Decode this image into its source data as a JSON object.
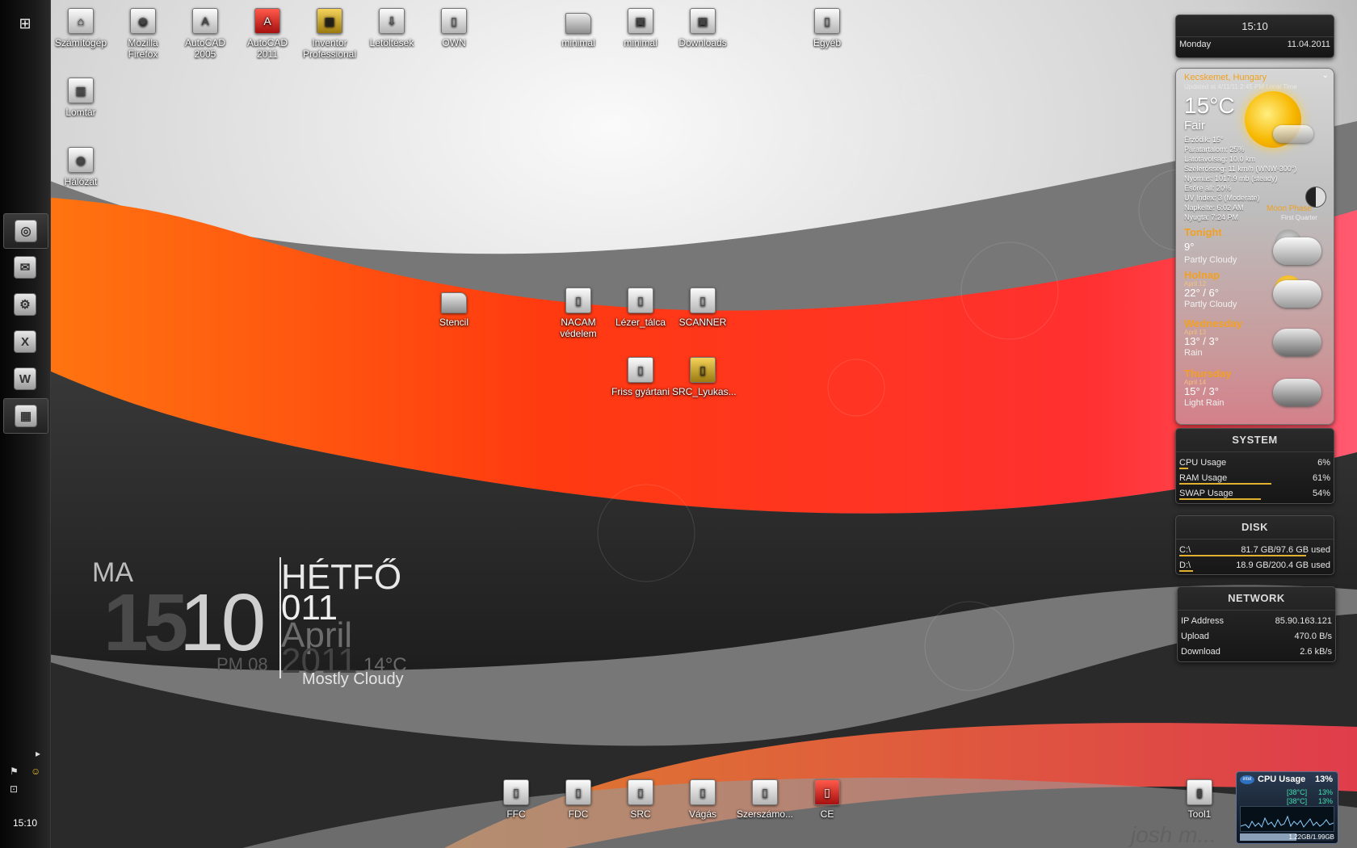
{
  "taskbar": {
    "start_icon": "windows-logo-icon",
    "buttons": [
      {
        "name": "chrome",
        "glyph": "◎",
        "active": true
      },
      {
        "name": "mail",
        "glyph": "✉",
        "active": false
      },
      {
        "name": "settings",
        "glyph": "⚙",
        "active": false
      },
      {
        "name": "excel",
        "glyph": "X",
        "active": false
      },
      {
        "name": "word",
        "glyph": "W",
        "active": false
      },
      {
        "name": "inventor",
        "glyph": "▦",
        "active": true
      }
    ],
    "clock": "15:10"
  },
  "desktop_icons": [
    {
      "label": "Számítógép",
      "glyph": "⌂",
      "kind": ""
    },
    {
      "label": "Mozilla Firefox",
      "glyph": "◉",
      "kind": ""
    },
    {
      "label": "AutoCAD 2005",
      "glyph": "A",
      "kind": ""
    },
    {
      "label": "AutoCAD 2011",
      "glyph": "A",
      "kind": "red"
    },
    {
      "label": "Inventor Professional",
      "glyph": "▦",
      "kind": "yellow"
    },
    {
      "label": "Letöltések",
      "glyph": "⇩",
      "kind": ""
    },
    {
      "label": "OWN",
      "glyph": "▯",
      "kind": ""
    },
    {
      "label": "minimal",
      "glyph": "",
      "kind": "folder"
    },
    {
      "label": "minimal",
      "glyph": "▣",
      "kind": ""
    },
    {
      "label": "Downloads",
      "glyph": "▣",
      "kind": ""
    },
    {
      "label": "Egyéb",
      "glyph": "▯",
      "kind": ""
    },
    {
      "label": "Lomtár",
      "glyph": "▥",
      "kind": ""
    },
    {
      "label": "Hálózat",
      "glyph": "◍",
      "kind": ""
    },
    {
      "label": "Stencil",
      "glyph": "",
      "kind": "folder"
    },
    {
      "label": "NACAM védelem",
      "glyph": "▯",
      "kind": ""
    },
    {
      "label": "Lézer_tálca",
      "glyph": "▯",
      "kind": ""
    },
    {
      "label": "SCANNER",
      "glyph": "▯",
      "kind": ""
    },
    {
      "label": "Friss gyártani",
      "glyph": "▯",
      "kind": ""
    },
    {
      "label": "SRC_Lyukas...",
      "glyph": "▯",
      "kind": "yellow"
    },
    {
      "label": "FFC",
      "glyph": "▯",
      "kind": ""
    },
    {
      "label": "FDC",
      "glyph": "▯",
      "kind": ""
    },
    {
      "label": "SRC",
      "glyph": "▯",
      "kind": ""
    },
    {
      "label": "Vágás",
      "glyph": "▯",
      "kind": ""
    },
    {
      "label": "Szerszámo...",
      "glyph": "▯",
      "kind": ""
    },
    {
      "label": "CE",
      "glyph": "▯",
      "kind": "red"
    },
    {
      "label": "Tool1",
      "glyph": "▮",
      "kind": ""
    }
  ],
  "bigclock": {
    "ma": "MA",
    "hour": "15",
    "minute": "10",
    "day": "HÉTFŐ",
    "date": "011",
    "month": "April",
    "year": "2011",
    "pm": "PM 08",
    "temp": "14°C",
    "condition": "Mostly Cloudy"
  },
  "clock_gadget": {
    "time": "15:10",
    "day": "Monday",
    "date": "11.04.2011"
  },
  "weather": {
    "city": "Kecskemet, Hungary",
    "updated": "Updated at 4/11/11 2:45 PM Local Time",
    "temp": "15°C",
    "condition": "Fair",
    "details": [
      "Érződik: 15°",
      "Páratartalom: 25%",
      "Látótávolság: 10.0 km",
      "Szélerősség: 11 km/h (WNW-300°)",
      "Nyomás: 1017.9 mb (steady)",
      "Esőre áll: 20%",
      "UV Index: 3 (Moderate)",
      "Napkelte: 6:02 AM",
      "Nyugta: 7:24 PM"
    ],
    "moon_label": "Moon Phase",
    "moon_sub": "First Quarter",
    "forecast": [
      {
        "day": "Tonight",
        "sub": "",
        "temp": "9°",
        "cond": "Partly Cloudy",
        "icon": "moon-cloud-icon"
      },
      {
        "day": "Holnap",
        "sub": "April 12",
        "temp": "22° / 6°",
        "cond": "Partly Cloudy",
        "icon": "sun-cloud-icon"
      },
      {
        "day": "Wednesday",
        "sub": "April 13",
        "temp": "13° / 3°",
        "cond": "Rain",
        "icon": "rain-cloud-icon"
      },
      {
        "day": "Thursday",
        "sub": "April 14",
        "temp": "15° / 3°",
        "cond": "Light Rain",
        "icon": "rain-cloud-icon"
      }
    ]
  },
  "system": {
    "title": "SYSTEM",
    "rows": [
      {
        "label": "CPU Usage",
        "value": "6%",
        "fill": 0.06
      },
      {
        "label": "RAM Usage",
        "value": "61%",
        "fill": 0.61
      },
      {
        "label": "SWAP Usage",
        "value": "54%",
        "fill": 0.54
      }
    ]
  },
  "disk": {
    "title": "DISK",
    "rows": [
      {
        "label": "C:\\",
        "value": "81.7 GB/97.6 GB used",
        "fill": 0.84
      },
      {
        "label": "D:\\",
        "value": "18.9 GB/200.4 GB used",
        "fill": 0.09
      }
    ]
  },
  "network": {
    "title": "NETWORK",
    "rows": [
      {
        "label": "IP Address",
        "value": "85.90.163.121"
      },
      {
        "label": "Upload",
        "value": "470.0 B/s"
      },
      {
        "label": "Download",
        "value": "2.6 kB/s"
      }
    ]
  },
  "cpu_meter": {
    "logo": "intel",
    "title": "CPU Usage",
    "value": "13%",
    "cores": [
      {
        "temp": "[38°C]",
        "usage": "13%"
      },
      {
        "temp": "[38°C]",
        "usage": "13%"
      }
    ],
    "memory": "1.22GB/1.99GB",
    "memory_fill": 0.61
  },
  "watermark": "josh m..."
}
